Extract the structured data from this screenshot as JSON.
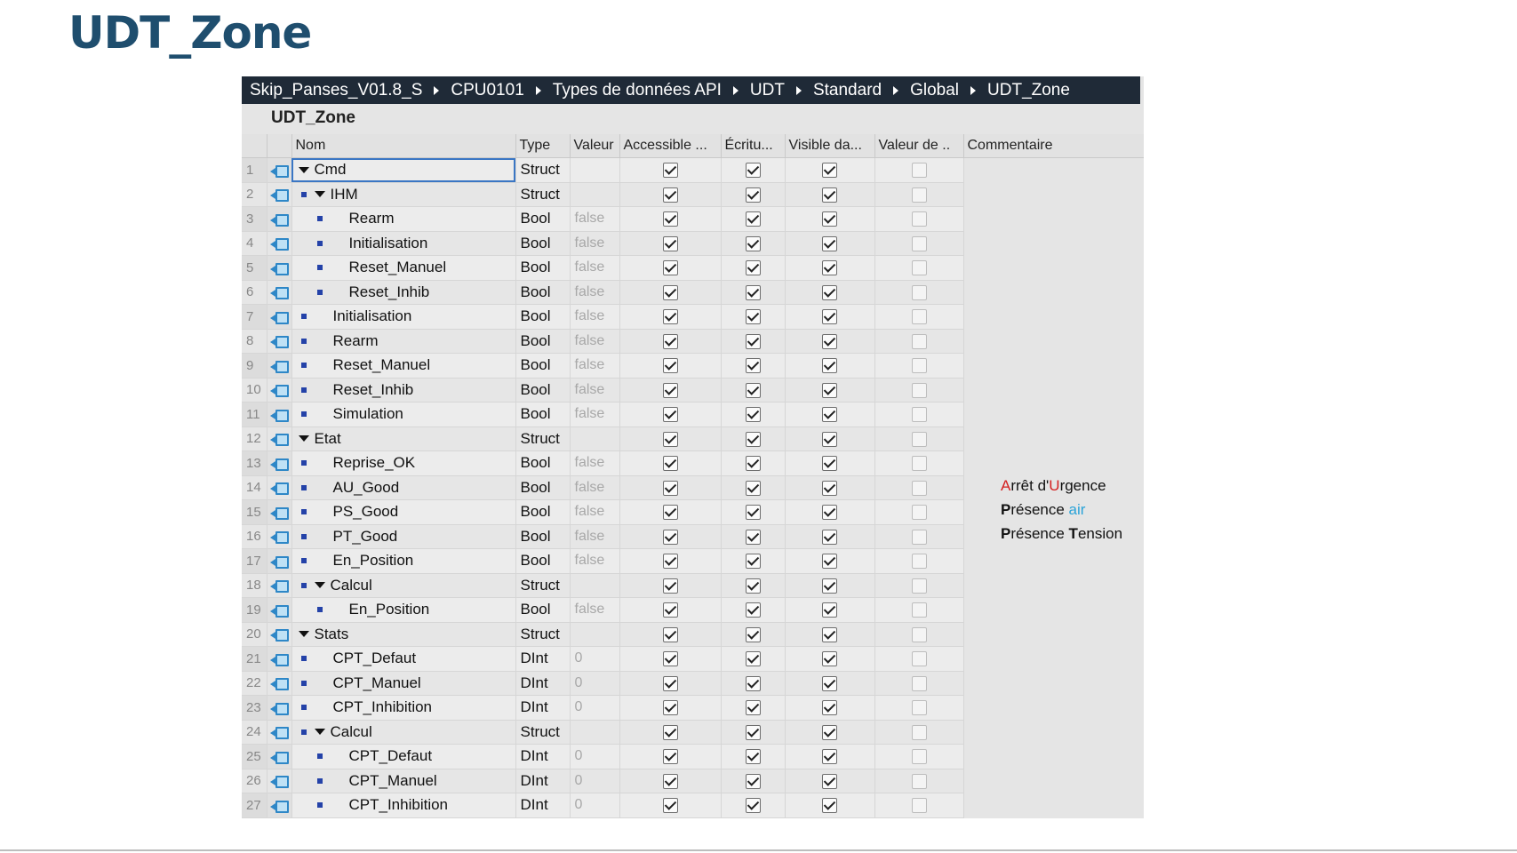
{
  "slide": {
    "title": "UDT_Zone"
  },
  "breadcrumb": [
    "Skip_Panses_V01.8_S",
    "CPU0101",
    "Types de données API",
    "UDT",
    "Standard",
    "Global",
    "UDT_Zone"
  ],
  "editor": {
    "title": "UDT_Zone"
  },
  "columns": {
    "nom": "Nom",
    "type": "Type",
    "valeur": "Valeur",
    "accessible": "Accessible ...",
    "ecriture": "Écritu...",
    "visible": "Visible da...",
    "valeur_defaut": "Valeur de ..",
    "commentaire": "Commentaire"
  },
  "rows": [
    {
      "n": "1",
      "level": 0,
      "expand": true,
      "name": "Cmd",
      "type": "Struct",
      "value": "",
      "selected": true
    },
    {
      "n": "2",
      "level": 1,
      "expand": true,
      "name": "IHM",
      "type": "Struct",
      "value": ""
    },
    {
      "n": "3",
      "level": 2,
      "expand": false,
      "name": "Rearm",
      "type": "Bool",
      "value": "false"
    },
    {
      "n": "4",
      "level": 2,
      "expand": false,
      "name": "Initialisation",
      "type": "Bool",
      "value": "false"
    },
    {
      "n": "5",
      "level": 2,
      "expand": false,
      "name": "Reset_Manuel",
      "type": "Bool",
      "value": "false"
    },
    {
      "n": "6",
      "level": 2,
      "expand": false,
      "name": "Reset_Inhib",
      "type": "Bool",
      "value": "false"
    },
    {
      "n": "7",
      "level": 1,
      "expand": false,
      "name": "Initialisation",
      "type": "Bool",
      "value": "false"
    },
    {
      "n": "8",
      "level": 1,
      "expand": false,
      "name": "Rearm",
      "type": "Bool",
      "value": "false"
    },
    {
      "n": "9",
      "level": 1,
      "expand": false,
      "name": "Reset_Manuel",
      "type": "Bool",
      "value": "false"
    },
    {
      "n": "10",
      "level": 1,
      "expand": false,
      "name": "Reset_Inhib",
      "type": "Bool",
      "value": "false"
    },
    {
      "n": "11",
      "level": 1,
      "expand": false,
      "name": "Simulation",
      "type": "Bool",
      "value": "false"
    },
    {
      "n": "12",
      "level": 0,
      "expand": true,
      "name": "Etat",
      "type": "Struct",
      "value": ""
    },
    {
      "n": "13",
      "level": 1,
      "expand": false,
      "name": "Reprise_OK",
      "type": "Bool",
      "value": "false"
    },
    {
      "n": "14",
      "level": 1,
      "expand": false,
      "name": "AU_Good",
      "type": "Bool",
      "value": "false"
    },
    {
      "n": "15",
      "level": 1,
      "expand": false,
      "name": "PS_Good",
      "type": "Bool",
      "value": "false"
    },
    {
      "n": "16",
      "level": 1,
      "expand": false,
      "name": "PT_Good",
      "type": "Bool",
      "value": "false"
    },
    {
      "n": "17",
      "level": 1,
      "expand": false,
      "name": "En_Position",
      "type": "Bool",
      "value": "false"
    },
    {
      "n": "18",
      "level": 1,
      "expand": true,
      "name": "Calcul",
      "type": "Struct",
      "value": ""
    },
    {
      "n": "19",
      "level": 2,
      "expand": false,
      "name": "En_Position",
      "type": "Bool",
      "value": "false"
    },
    {
      "n": "20",
      "level": 0,
      "expand": true,
      "name": "Stats",
      "type": "Struct",
      "value": ""
    },
    {
      "n": "21",
      "level": 1,
      "expand": false,
      "name": "CPT_Defaut",
      "type": "DInt",
      "value": "0"
    },
    {
      "n": "22",
      "level": 1,
      "expand": false,
      "name": "CPT_Manuel",
      "type": "DInt",
      "value": "0"
    },
    {
      "n": "23",
      "level": 1,
      "expand": false,
      "name": "CPT_Inhibition",
      "type": "DInt",
      "value": "0"
    },
    {
      "n": "24",
      "level": 1,
      "expand": true,
      "name": "Calcul",
      "type": "Struct",
      "value": ""
    },
    {
      "n": "25",
      "level": 2,
      "expand": false,
      "name": "CPT_Defaut",
      "type": "DInt",
      "value": "0"
    },
    {
      "n": "26",
      "level": 2,
      "expand": false,
      "name": "CPT_Manuel",
      "type": "DInt",
      "value": "0"
    },
    {
      "n": "27",
      "level": 2,
      "expand": false,
      "name": "CPT_Inhibition",
      "type": "DInt",
      "value": "0"
    }
  ],
  "comments": {
    "au": {
      "hl1": "A",
      "t1": "rrêt d'",
      "hl2": "U",
      "t2": "rgence"
    },
    "ps": {
      "hl1": "P",
      "t1": "résence ",
      "hl2": "air"
    },
    "pt": {
      "hl1": "P",
      "t1": "résence ",
      "hl2": "T",
      "t2": "ension"
    }
  },
  "colors": {
    "title": "#1f4e6e",
    "breadcrumb_bg": "#1f2a37",
    "red": "#d42020",
    "cyan": "#2aa3d8"
  }
}
